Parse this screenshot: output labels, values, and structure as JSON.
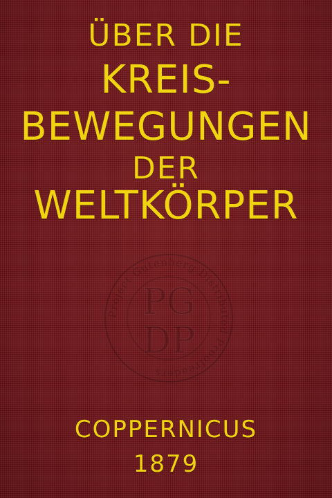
{
  "cover": {
    "title_line_1": "ÜBER DIE",
    "title_line_2": "KREIS-",
    "title_line_3": "BEWEGUNGEN",
    "title_line_4": "DER",
    "title_line_5": "WELTKÖRPER",
    "author": "COPPERNICUS",
    "year": "1879"
  },
  "seal": {
    "ring_text": "Project Gutenberg Distributed Proofreaders",
    "initials_top": "PG",
    "initials_bottom": "DP"
  },
  "colors": {
    "background": "#6f1519",
    "lettering": "#f1d410"
  }
}
